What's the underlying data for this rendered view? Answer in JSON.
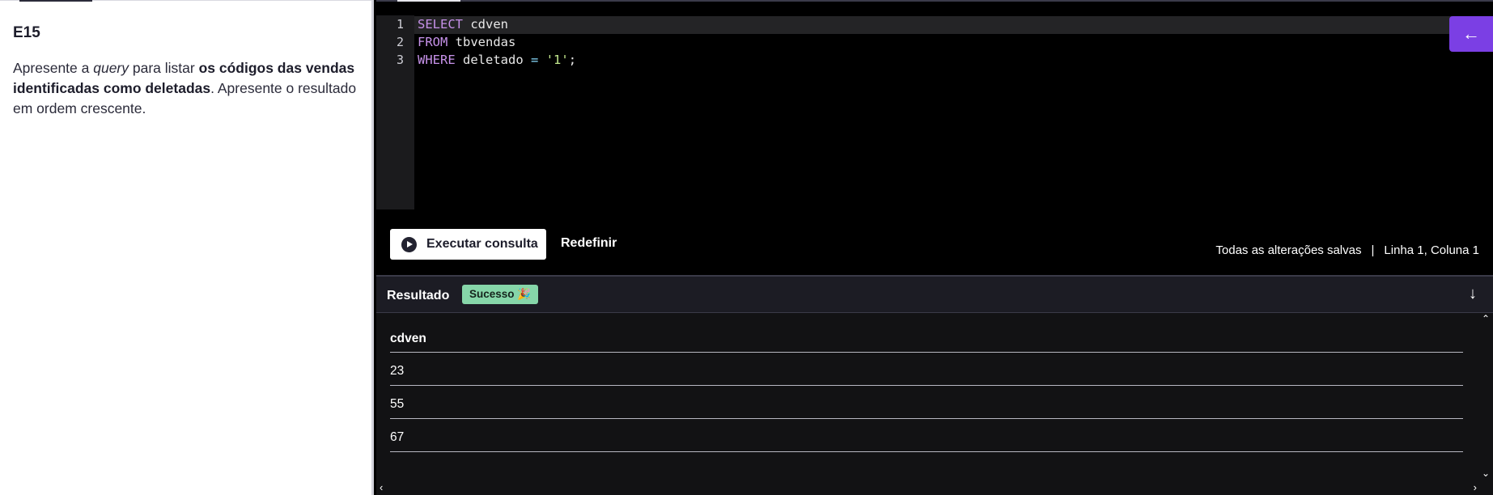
{
  "exercise": {
    "title": "E15",
    "text_1": "Apresente a ",
    "text_italic": "query",
    "text_2": " para listar ",
    "text_bold": "os códigos das vendas identificadas como deletadas",
    "text_3": ". Apresente o resultado em ordem crescente."
  },
  "editor": {
    "line_numbers": [
      "1",
      "2",
      "3"
    ],
    "lines": [
      {
        "keyword": "SELECT",
        "rest": " cdven"
      },
      {
        "keyword": "FROM",
        "rest": " tbvendas"
      },
      {
        "keyword": "WHERE",
        "rest_a": " deletado ",
        "op": "=",
        "string": "'1'",
        "end": ";"
      }
    ]
  },
  "toolbar": {
    "run_label": "Executar consulta",
    "reset_label": "Redefinir",
    "save_status": "Todas as alterações salvas",
    "separator": "|",
    "cursor_position": "Linha 1, Coluna 1",
    "back_icon": "←"
  },
  "result": {
    "title": "Resultado",
    "badge": "Sucesso 🎉",
    "collapse_icon": "↓",
    "column": "cdven",
    "rows": [
      "23",
      "55",
      "67"
    ]
  },
  "colors": {
    "accent": "#7b3fe4",
    "success": "#86d6a9",
    "keyword": "#c792ea",
    "string": "#c3e88d"
  }
}
